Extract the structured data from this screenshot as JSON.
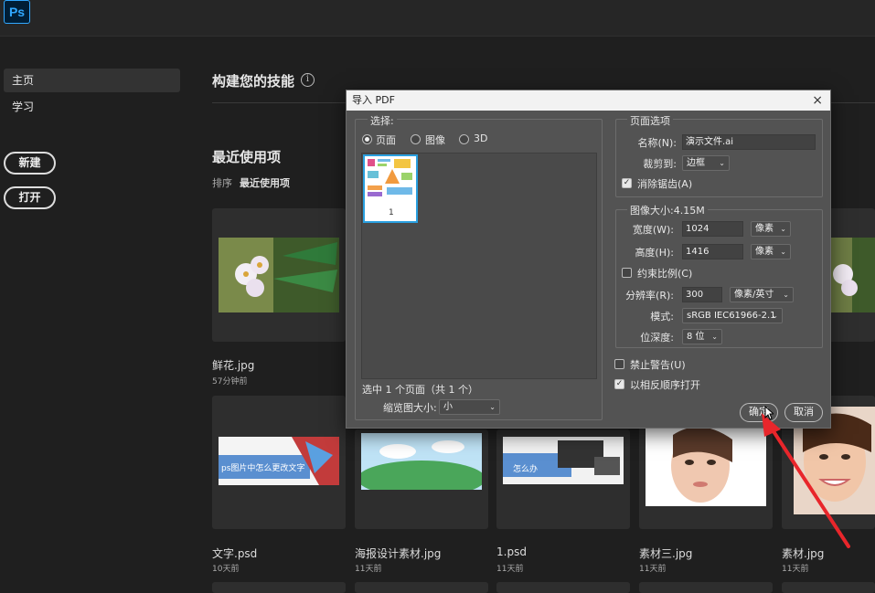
{
  "app": {
    "logo": "Ps"
  },
  "sidebar": {
    "items": [
      {
        "label": "主页"
      },
      {
        "label": "学习"
      }
    ],
    "new_button": "新建",
    "open_button": "打开"
  },
  "main": {
    "skills_heading": "构建您的技能",
    "recent_heading": "最近使用项",
    "sort_label": "排序",
    "sort_value": "最近使用项",
    "files": [
      {
        "name": "鲜花.jpg",
        "time": "57分钟前"
      },
      {
        "name": "文字.psd",
        "time": "10天前",
        "caption": "ps图片中怎么更改文字"
      },
      {
        "name": "海报设计素材.jpg",
        "time": "11天前"
      },
      {
        "name": "1.psd",
        "time": "11天前",
        "caption": "怎么办"
      },
      {
        "name": "素材三.jpg",
        "time": "11天前"
      },
      {
        "name": "素材.jpg",
        "time": "11天前"
      }
    ]
  },
  "dialog": {
    "title": "导入 PDF",
    "close": "×",
    "select": {
      "legend": "选择:",
      "options": [
        {
          "label": "页面",
          "selected": true
        },
        {
          "label": "图像",
          "selected": false
        },
        {
          "label": "3D",
          "selected": false
        }
      ],
      "page_number": "1",
      "status": "选中 1 个页面（共 1 个）",
      "thumb_size_label": "缩览图大小:",
      "thumb_size_value": "小"
    },
    "page_options": {
      "legend": "页面选项",
      "name_label": "名称(N):",
      "name_value": "演示文件.ai",
      "crop_label": "裁剪到:",
      "crop_value": "边框",
      "antialias_label": "消除锯齿(A)",
      "antialias_checked": true
    },
    "image_size": {
      "legend": "图像大小:4.15M",
      "width_label": "宽度(W):",
      "width_value": "1024",
      "width_unit": "像素",
      "height_label": "高度(H):",
      "height_value": "1416",
      "height_unit": "像素",
      "constrain_label": "约束比例(C)",
      "constrain_checked": false,
      "resolution_label": "分辨率(R):",
      "resolution_value": "300",
      "resolution_unit": "像素/英寸",
      "mode_label": "模式:",
      "mode_value": "sRGB IEC61966-2.1",
      "depth_label": "位深度:",
      "depth_value": "8 位"
    },
    "suppress_warnings_label": "禁止警告(U)",
    "suppress_warnings_checked": false,
    "reverse_order_label": "以相反顺序打开",
    "reverse_order_checked": true,
    "ok_button": "确定",
    "cancel_button": "取消"
  },
  "colors": {
    "accent": "#31a8ff",
    "annotation_arrow": "#e8262b",
    "selection_border": "#2aa0e0"
  }
}
